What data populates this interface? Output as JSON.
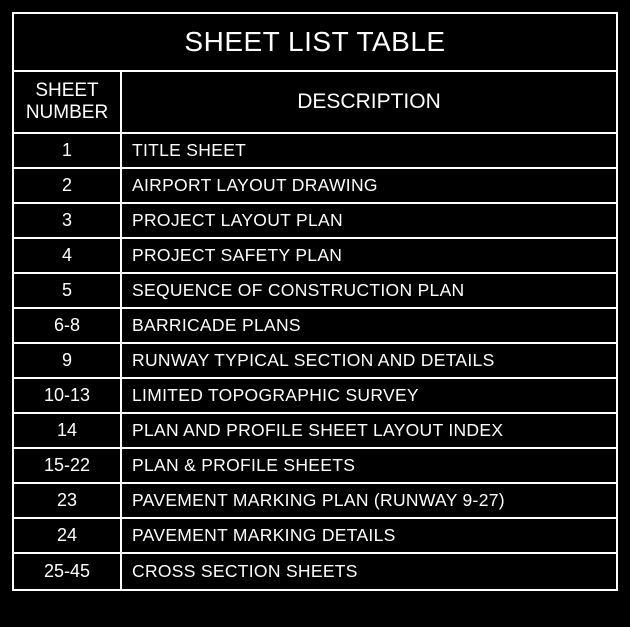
{
  "chart_data": {
    "type": "table",
    "title": "SHEET LIST TABLE",
    "columns": [
      "SHEET NUMBER",
      "DESCRIPTION"
    ],
    "rows": [
      {
        "number": "1",
        "description": "TITLE SHEET"
      },
      {
        "number": "2",
        "description": "AIRPORT LAYOUT DRAWING"
      },
      {
        "number": "3",
        "description": "PROJECT LAYOUT PLAN"
      },
      {
        "number": "4",
        "description": "PROJECT SAFETY PLAN"
      },
      {
        "number": "5",
        "description": "SEQUENCE OF CONSTRUCTION PLAN"
      },
      {
        "number": "6-8",
        "description": "BARRICADE PLANS"
      },
      {
        "number": "9",
        "description": "RUNWAY TYPICAL SECTION AND DETAILS"
      },
      {
        "number": "10-13",
        "description": "LIMITED TOPOGRAPHIC SURVEY"
      },
      {
        "number": "14",
        "description": "PLAN AND PROFILE SHEET LAYOUT INDEX"
      },
      {
        "number": "15-22",
        "description": "PLAN & PROFILE SHEETS"
      },
      {
        "number": "23",
        "description": "PAVEMENT MARKING PLAN (RUNWAY 9-27)"
      },
      {
        "number": "24",
        "description": "PAVEMENT MARKING DETAILS"
      },
      {
        "number": "25-45",
        "description": "CROSS SECTION SHEETS"
      }
    ]
  },
  "title": "SHEET LIST TABLE",
  "header": {
    "col1_line1": "SHEET",
    "col1_line2": "NUMBER",
    "col2": "DESCRIPTION"
  },
  "rows": [
    {
      "number": "1",
      "description": "TITLE SHEET"
    },
    {
      "number": "2",
      "description": "AIRPORT LAYOUT DRAWING"
    },
    {
      "number": "3",
      "description": "PROJECT LAYOUT PLAN"
    },
    {
      "number": "4",
      "description": "PROJECT SAFETY PLAN"
    },
    {
      "number": "5",
      "description": "SEQUENCE OF CONSTRUCTION PLAN"
    },
    {
      "number": "6-8",
      "description": "BARRICADE PLANS"
    },
    {
      "number": "9",
      "description": "RUNWAY TYPICAL SECTION AND DETAILS"
    },
    {
      "number": "10-13",
      "description": "LIMITED TOPOGRAPHIC SURVEY"
    },
    {
      "number": "14",
      "description": "PLAN AND PROFILE SHEET LAYOUT INDEX"
    },
    {
      "number": "15-22",
      "description": "PLAN & PROFILE SHEETS"
    },
    {
      "number": "23",
      "description": "PAVEMENT MARKING PLAN (RUNWAY 9-27)"
    },
    {
      "number": "24",
      "description": "PAVEMENT MARKING DETAILS"
    },
    {
      "number": "25-45",
      "description": "CROSS SECTION SHEETS"
    }
  ]
}
